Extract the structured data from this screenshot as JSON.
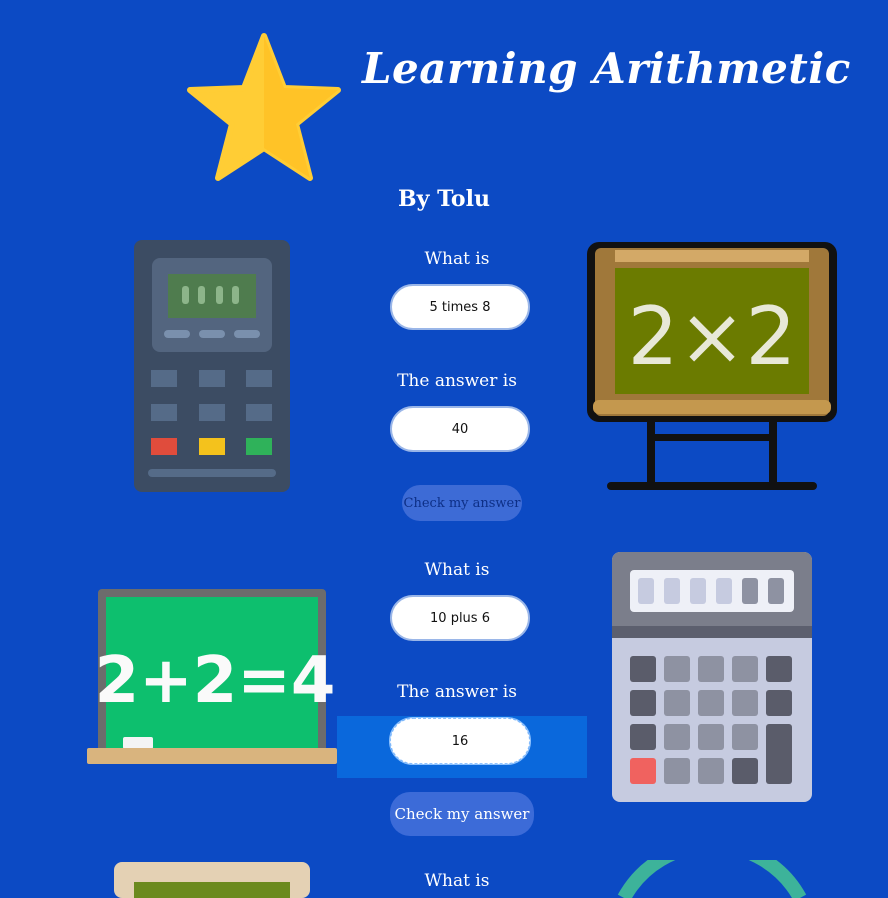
{
  "header": {
    "title": "Learning Arithmetic",
    "byline": "By Tolu"
  },
  "questions": [
    {
      "prompt_label": "What is",
      "question": "5 times 8",
      "answer_label": "The answer is",
      "answer": "40",
      "button": "Check my answer"
    },
    {
      "prompt_label": "What is",
      "question": "10 plus 6",
      "answer_label": "The answer is",
      "answer": "16",
      "button": "Check my answer"
    },
    {
      "prompt_label": "What is"
    }
  ],
  "art": {
    "chalkboard_stand_text": "2×2",
    "green_board_text": "2+2=4"
  },
  "colors": {
    "background": "#0c4ac4",
    "star": "#ffcd35",
    "focus": "#0a68dc"
  }
}
